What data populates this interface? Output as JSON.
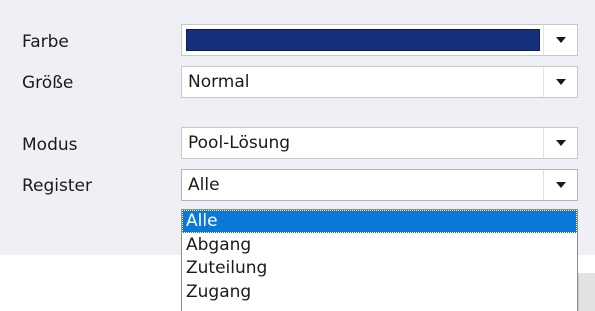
{
  "form": {
    "color": {
      "label": "Farbe",
      "value_color": "#15307a"
    },
    "size": {
      "label": "Größe",
      "value": "Normal"
    },
    "mode": {
      "label": "Modus",
      "value": "Pool-Lösung"
    },
    "register": {
      "label": "Register",
      "value": "Alle",
      "options": [
        "Alle",
        "Abgang",
        "Zuteilung",
        "Zugang"
      ],
      "highlighted_option": "Alle"
    }
  },
  "icons": {
    "dropdown_arrow": "chevron-down-icon"
  },
  "colors": {
    "selection": "#0a78d7",
    "panel_background": "#eef0f5"
  }
}
